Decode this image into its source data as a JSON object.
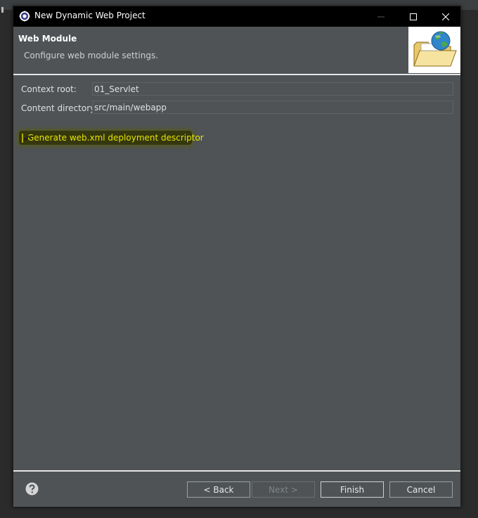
{
  "window": {
    "title": "New Dynamic Web Project"
  },
  "header": {
    "title": "Web Module",
    "description": "Configure web module settings."
  },
  "form": {
    "context_root_label": "Context root:",
    "context_root_value": "01_Servlet",
    "content_dir_label": "Content directory:",
    "content_dir_value": "src/main/webapp"
  },
  "checkbox": {
    "label": "Generate web.xml deployment descriptor",
    "checked": true
  },
  "buttons": {
    "back": "< Back",
    "next": "Next >",
    "finish": "Finish",
    "cancel": "Cancel"
  },
  "icons": {
    "app": "eclipse-gear-icon",
    "help": "help-icon",
    "header": "folder-globe-icon"
  },
  "colors": {
    "highlight": "#e2e600",
    "dialog_bg": "#4f5355",
    "titlebar_bg": "#000000"
  }
}
